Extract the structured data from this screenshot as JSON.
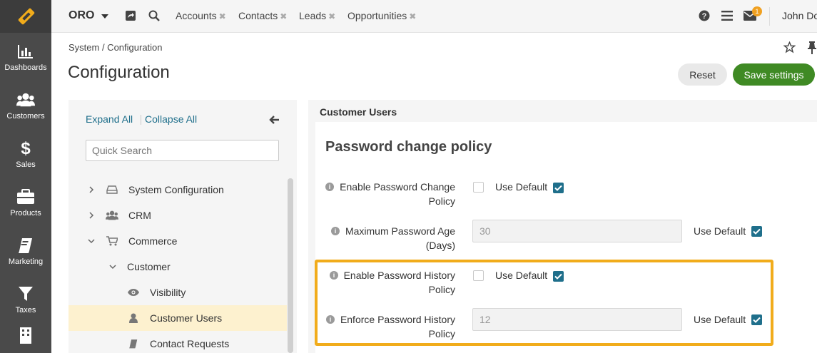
{
  "app": {
    "brand": "ORO"
  },
  "sidebar": {
    "items": [
      {
        "label": "Dashboards",
        "icon": "bar-chart-icon"
      },
      {
        "label": "Customers",
        "icon": "users-icon"
      },
      {
        "label": "Sales",
        "icon": "dollar-icon"
      },
      {
        "label": "Products",
        "icon": "briefcase-icon"
      },
      {
        "label": "Marketing",
        "icon": "book-icon"
      },
      {
        "label": "Taxes",
        "icon": "filter-icon"
      }
    ]
  },
  "topbar": {
    "tabs": [
      "Accounts",
      "Contacts",
      "Leads",
      "Opportunities"
    ],
    "close_glyph": "✖",
    "notification_count": "1",
    "user": "John Do"
  },
  "header": {
    "breadcrumb": "System / Configuration",
    "title": "Configuration",
    "reset_label": "Reset",
    "save_label": "Save settings"
  },
  "tree": {
    "expand_all": "Expand All",
    "collapse_all": "Collapse All",
    "search_placeholder": "Quick Search",
    "items": [
      {
        "label": "System Configuration",
        "icon": "drive-icon"
      },
      {
        "label": "CRM",
        "icon": "users-icon"
      },
      {
        "label": "Commerce",
        "icon": "cart-icon"
      },
      {
        "label": "Customer",
        "icon": ""
      },
      {
        "label": "Visibility",
        "icon": "eye-icon"
      },
      {
        "label": "Customer Users",
        "icon": "user-icon"
      },
      {
        "label": "Contact Requests",
        "icon": "book-icon"
      }
    ]
  },
  "content": {
    "section": "Customer Users",
    "policy_title": "Password change policy",
    "use_default": "Use Default",
    "fields": [
      {
        "label_1": "Enable Password Change",
        "label_2": "Policy"
      },
      {
        "label_1": "Maximum Password Age",
        "label_2": "(Days)",
        "value": "30"
      },
      {
        "label_1": "Enable Password History",
        "label_2": "Policy"
      },
      {
        "label_1": "Enforce Password History",
        "label_2": "Policy",
        "value": "12"
      }
    ]
  },
  "colors": {
    "accent": "#1f6f8b",
    "save": "#3f8a24",
    "highlight": "#f1ac1b",
    "sidebar": "#4a4a4a"
  }
}
